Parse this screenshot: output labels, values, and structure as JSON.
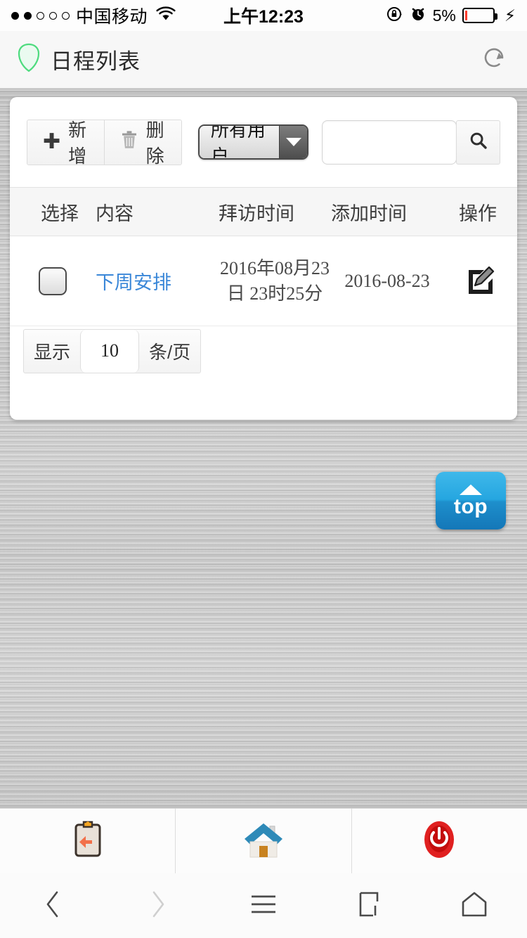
{
  "statusbar": {
    "signal_dots_total": 5,
    "signal_dots_filled": 2,
    "carrier": "中国移动",
    "wifi_icon": "wifi-icon",
    "time": "上午12:23",
    "rotation_lock_icon": "rotation-lock-icon",
    "alarm_icon": "alarm-clock-icon",
    "battery_percent": "5%",
    "battery_level": 5,
    "battery_color": "#fc3b2d",
    "charging_icon": "lightning-bolt-icon"
  },
  "header": {
    "shield_icon": "shield-icon",
    "shield_color": "#4ddb7e",
    "title": "日程列表",
    "refresh_icon": "refresh-icon"
  },
  "toolbar": {
    "add_label": "新增",
    "add_icon": "plus-icon",
    "delete_label": "删除",
    "delete_icon": "trash-icon",
    "user_filter_value": "所有用户",
    "dropdown_icon": "chevron-down-icon",
    "search_placeholder": "",
    "search_value": "",
    "search_icon": "search-icon"
  },
  "table": {
    "columns": [
      "选择",
      "内容",
      "拜访时间",
      "添加时间",
      "操作"
    ],
    "rows": [
      {
        "checked": false,
        "content": "下周安排",
        "visit_time": "2016年08月23日 23时25分",
        "add_time": "2016-08-23",
        "action_icon": "edit-pencil-icon"
      }
    ]
  },
  "pager": {
    "show_label": "显示",
    "page_size": "10",
    "unit_label": "条/页"
  },
  "top_button": {
    "label": "top",
    "arrow_icon": "chevron-up-icon",
    "color": "#25a6e0"
  },
  "app_toolbar": {
    "items": [
      {
        "icon": "clipboard-back-icon",
        "name": "back-to-list"
      },
      {
        "icon": "home-house-icon",
        "name": "home"
      },
      {
        "icon": "power-off-icon",
        "name": "logout"
      }
    ]
  },
  "nav_bar": {
    "items": [
      {
        "icon": "chevron-left-icon",
        "name": "browser-back",
        "enabled": true
      },
      {
        "icon": "chevron-right-icon",
        "name": "browser-forward",
        "enabled": false
      },
      {
        "icon": "hamburger-menu-icon",
        "name": "browser-menu",
        "enabled": true
      },
      {
        "icon": "tabs-icon",
        "name": "browser-tabs",
        "enabled": true
      },
      {
        "icon": "home-pentagon-icon",
        "name": "browser-home",
        "enabled": true
      }
    ]
  }
}
